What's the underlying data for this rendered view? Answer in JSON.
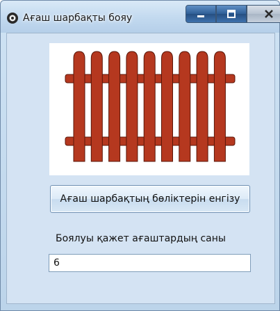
{
  "window": {
    "title": "Ағаш шарбақты  бояу",
    "icon": "app-icon",
    "controls": {
      "minimize": "minimize-icon",
      "maximize": "maximize-icon",
      "close": "close-icon"
    }
  },
  "picture": {
    "subject": "picket-fence",
    "color": "#b5381f",
    "outline": "#5a1608"
  },
  "button": {
    "label": "Ағаш шарбақтың  бөліктерін енгізу"
  },
  "result": {
    "label": "Боялуы қажет ағаштардың саны",
    "value": "6"
  }
}
